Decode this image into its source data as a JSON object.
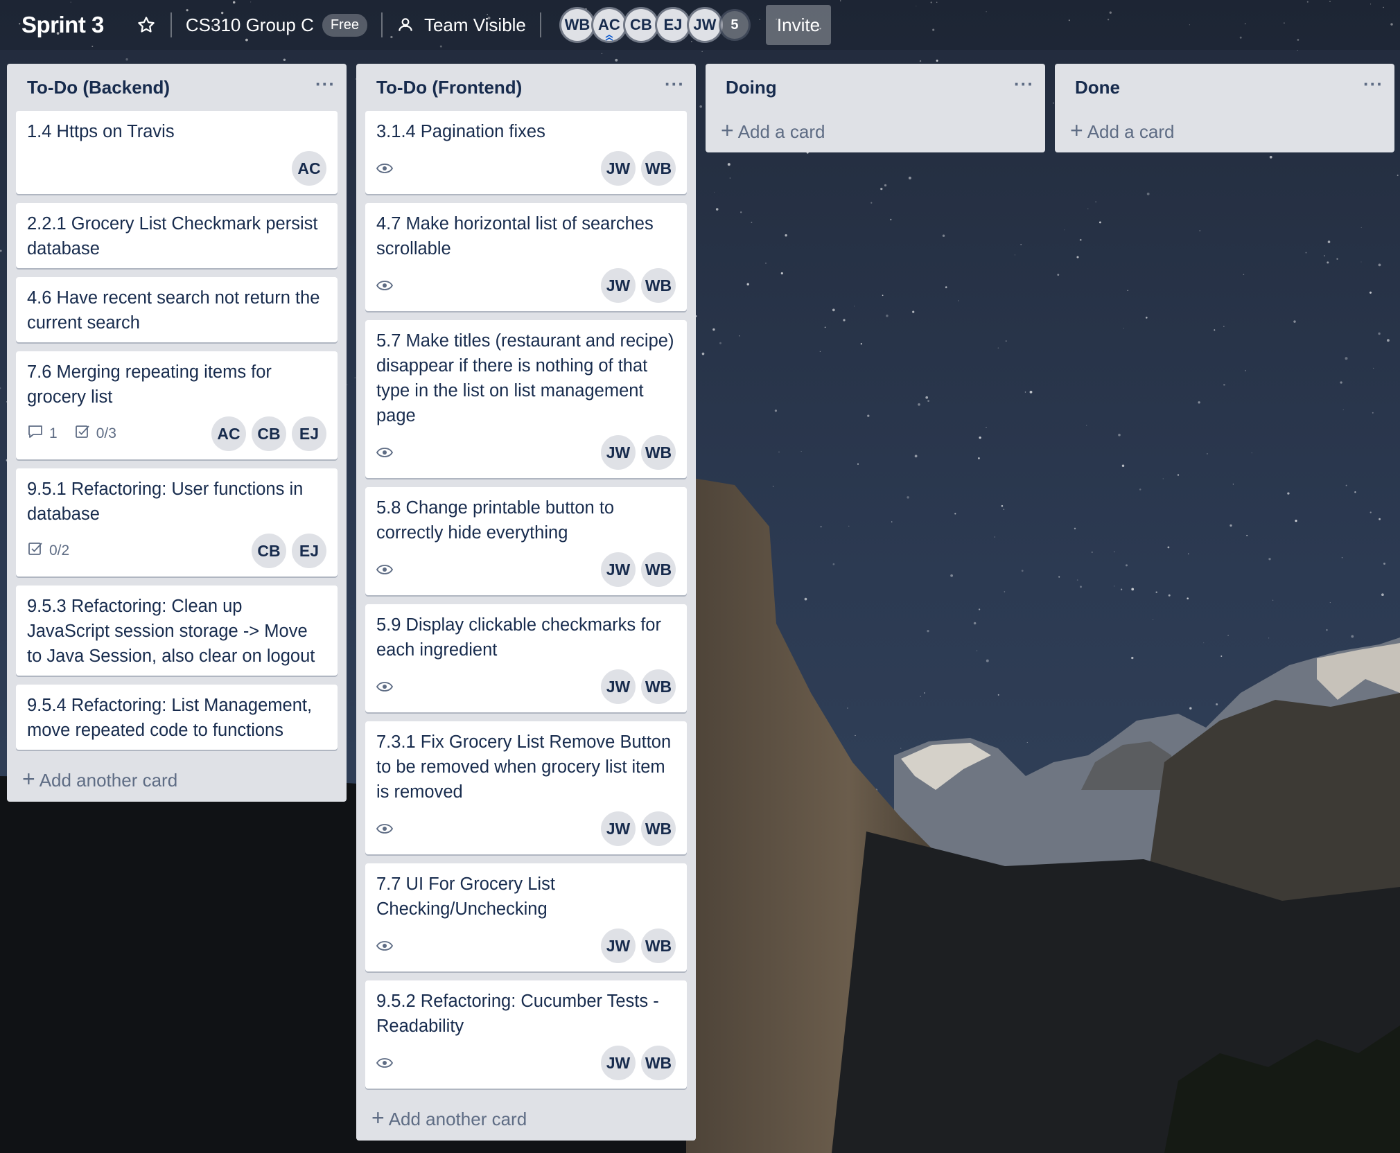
{
  "header": {
    "board_title": "Sprint 3",
    "team_name": "CS310 Group C",
    "plan_badge": "Free",
    "visibility": "Team Visible",
    "members": [
      "WB",
      "AC",
      "CB",
      "EJ",
      "JW"
    ],
    "member_overflow": "5",
    "invite_label": "Invite"
  },
  "colors": {
    "list_bg": "#dfe1e6",
    "card_bg": "#ffffff",
    "text": "#172b4d",
    "muted": "#5e6c84"
  },
  "lists": [
    {
      "title": "To-Do (Backend)",
      "menu": "···",
      "add_label": "Add another card",
      "cards": [
        {
          "title": "1.4 Https on Travis",
          "members": [
            "AC"
          ]
        },
        {
          "title": "2.2.1 Grocery List Checkmark persist database",
          "members": []
        },
        {
          "title": "4.6 Have recent search not return the current search",
          "members": []
        },
        {
          "title": "7.6 Merging repeating items for grocery list",
          "comments": "1",
          "checklist": "0/3",
          "members": [
            "AC",
            "CB",
            "EJ"
          ]
        },
        {
          "title": "9.5.1 Refactoring: User functions in database",
          "checklist": "0/2",
          "members": [
            "CB",
            "EJ"
          ]
        },
        {
          "title": "9.5.3 Refactoring: Clean up JavaScript session storage -> Move to Java Session, also clear on logout",
          "members": []
        },
        {
          "title": "9.5.4 Refactoring: List Management, move repeated code to functions",
          "members": []
        }
      ]
    },
    {
      "title": "To-Do (Frontend)",
      "menu": "···",
      "add_label": "Add another card",
      "cards": [
        {
          "title": "3.1.4 Pagination fixes",
          "watch": true,
          "members": [
            "JW",
            "WB"
          ]
        },
        {
          "title": "4.7 Make horizontal list of searches scrollable",
          "watch": true,
          "members": [
            "JW",
            "WB"
          ]
        },
        {
          "title": "5.7 Make titles (restaurant and recipe) disappear if there is nothing of that type in the list on list management page",
          "watch": true,
          "members": [
            "JW",
            "WB"
          ]
        },
        {
          "title": "5.8 Change printable button to correctly hide everything",
          "watch": true,
          "members": [
            "JW",
            "WB"
          ]
        },
        {
          "title": "5.9 Display clickable checkmarks for each ingredient",
          "watch": true,
          "members": [
            "JW",
            "WB"
          ]
        },
        {
          "title": "7.3.1 Fix Grocery List Remove Button to be removed when grocery list item is removed",
          "watch": true,
          "members": [
            "JW",
            "WB"
          ]
        },
        {
          "title": "7.7 UI For Grocery List Checking/Unchecking",
          "watch": true,
          "members": [
            "JW",
            "WB"
          ]
        },
        {
          "title": "9.5.2 Refactoring: Cucumber Tests - Readability",
          "watch": true,
          "members": [
            "JW",
            "WB"
          ]
        }
      ]
    },
    {
      "title": "Doing",
      "menu": "···",
      "add_label": "Add a card",
      "cards": []
    },
    {
      "title": "Done",
      "menu": "···",
      "add_label": "Add a card",
      "cards": []
    }
  ]
}
